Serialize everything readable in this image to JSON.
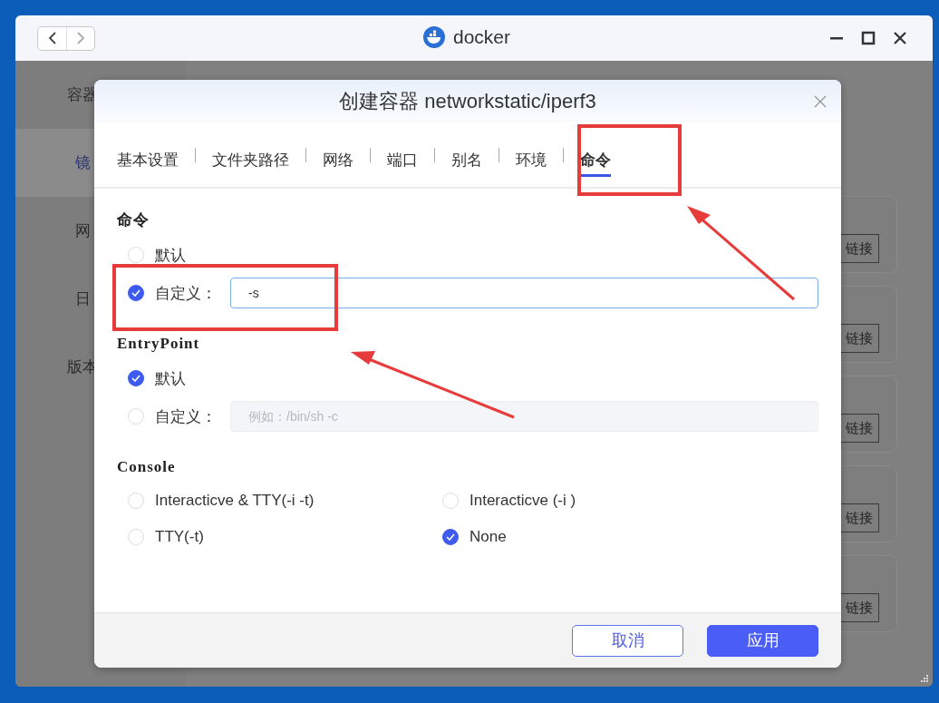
{
  "window": {
    "title": "docker"
  },
  "sidebar": {
    "items": [
      {
        "label": "容器",
        "selected": false
      },
      {
        "label": "镜",
        "selected": true
      },
      {
        "label": "网",
        "selected": false
      },
      {
        "label": "日",
        "selected": false
      },
      {
        "label": "版本",
        "selected": false
      }
    ]
  },
  "cards": [
    {
      "button": "链接"
    },
    {
      "button": "链接"
    },
    {
      "button": "链接"
    },
    {
      "button": "链接"
    },
    {
      "button": "链接"
    }
  ],
  "dialog": {
    "title": "创建容器 networkstatic/iperf3",
    "tabs": [
      {
        "label": "基本设置",
        "selected": false
      },
      {
        "label": "文件夹路径",
        "selected": false
      },
      {
        "label": "网络",
        "selected": false
      },
      {
        "label": "端口",
        "selected": false
      },
      {
        "label": "别名",
        "selected": false
      },
      {
        "label": "环境",
        "selected": false
      },
      {
        "label": "命令",
        "selected": true
      }
    ],
    "sections": [
      {
        "title": "命令",
        "kind": "list",
        "options": [
          {
            "label": "默认",
            "selected": false
          },
          {
            "label": "自定义：",
            "selected": true,
            "field": {
              "value": "-s",
              "disabled": false
            }
          }
        ]
      },
      {
        "title": "EntryPoint",
        "kind": "list",
        "options": [
          {
            "label": "默认",
            "selected": true
          },
          {
            "label": "自定义：",
            "selected": false,
            "field": {
              "placeholder": "例如：/bin/sh -c",
              "disabled": true
            }
          }
        ]
      },
      {
        "title": "Console",
        "kind": "grid",
        "options": [
          {
            "label": "Interacticve & TTY(-i -t)",
            "selected": false
          },
          {
            "label": "Interacticve (-i )",
            "selected": false
          },
          {
            "label": "TTY(-t)",
            "selected": false
          },
          {
            "label": "None",
            "selected": true
          }
        ]
      }
    ],
    "buttons": [
      {
        "label": "取消",
        "kind": "secondary"
      },
      {
        "label": "应用",
        "kind": "primary"
      }
    ]
  }
}
